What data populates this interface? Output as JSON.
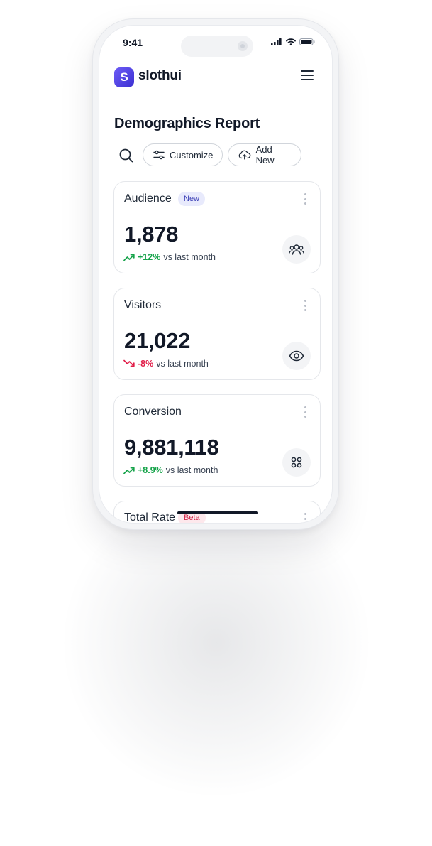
{
  "status_bar": {
    "time": "9:41"
  },
  "header": {
    "logo_letter": "S",
    "app_name": "slothui"
  },
  "page": {
    "title": "Demographics Report"
  },
  "toolbar": {
    "customize_label": "Customize",
    "add_new_label": "Add New"
  },
  "cards": [
    {
      "title": "Audience",
      "badge": "New",
      "value": "1,878",
      "trend_pct": "+12%",
      "trend_dir": "up",
      "trend_note": "vs last month",
      "icon": "users-icon"
    },
    {
      "title": "Visitors",
      "badge": "",
      "value": "21,022",
      "trend_pct": "-8%",
      "trend_dir": "down",
      "trend_note": "vs last month",
      "icon": "eye-icon"
    },
    {
      "title": "Conversion",
      "badge": "",
      "value": "9,881,118",
      "trend_pct": "+8.9%",
      "trend_dir": "up",
      "trend_note": "vs last month",
      "icon": "grid-icon"
    },
    {
      "title": "Total Rate",
      "badge": "Beta"
    }
  ],
  "colors": {
    "brand": "#4f46e5",
    "positive": "#16a34a",
    "negative": "#e11d48",
    "badge_new_bg": "#e8eafc",
    "badge_beta_bg": "#fde8ec"
  }
}
